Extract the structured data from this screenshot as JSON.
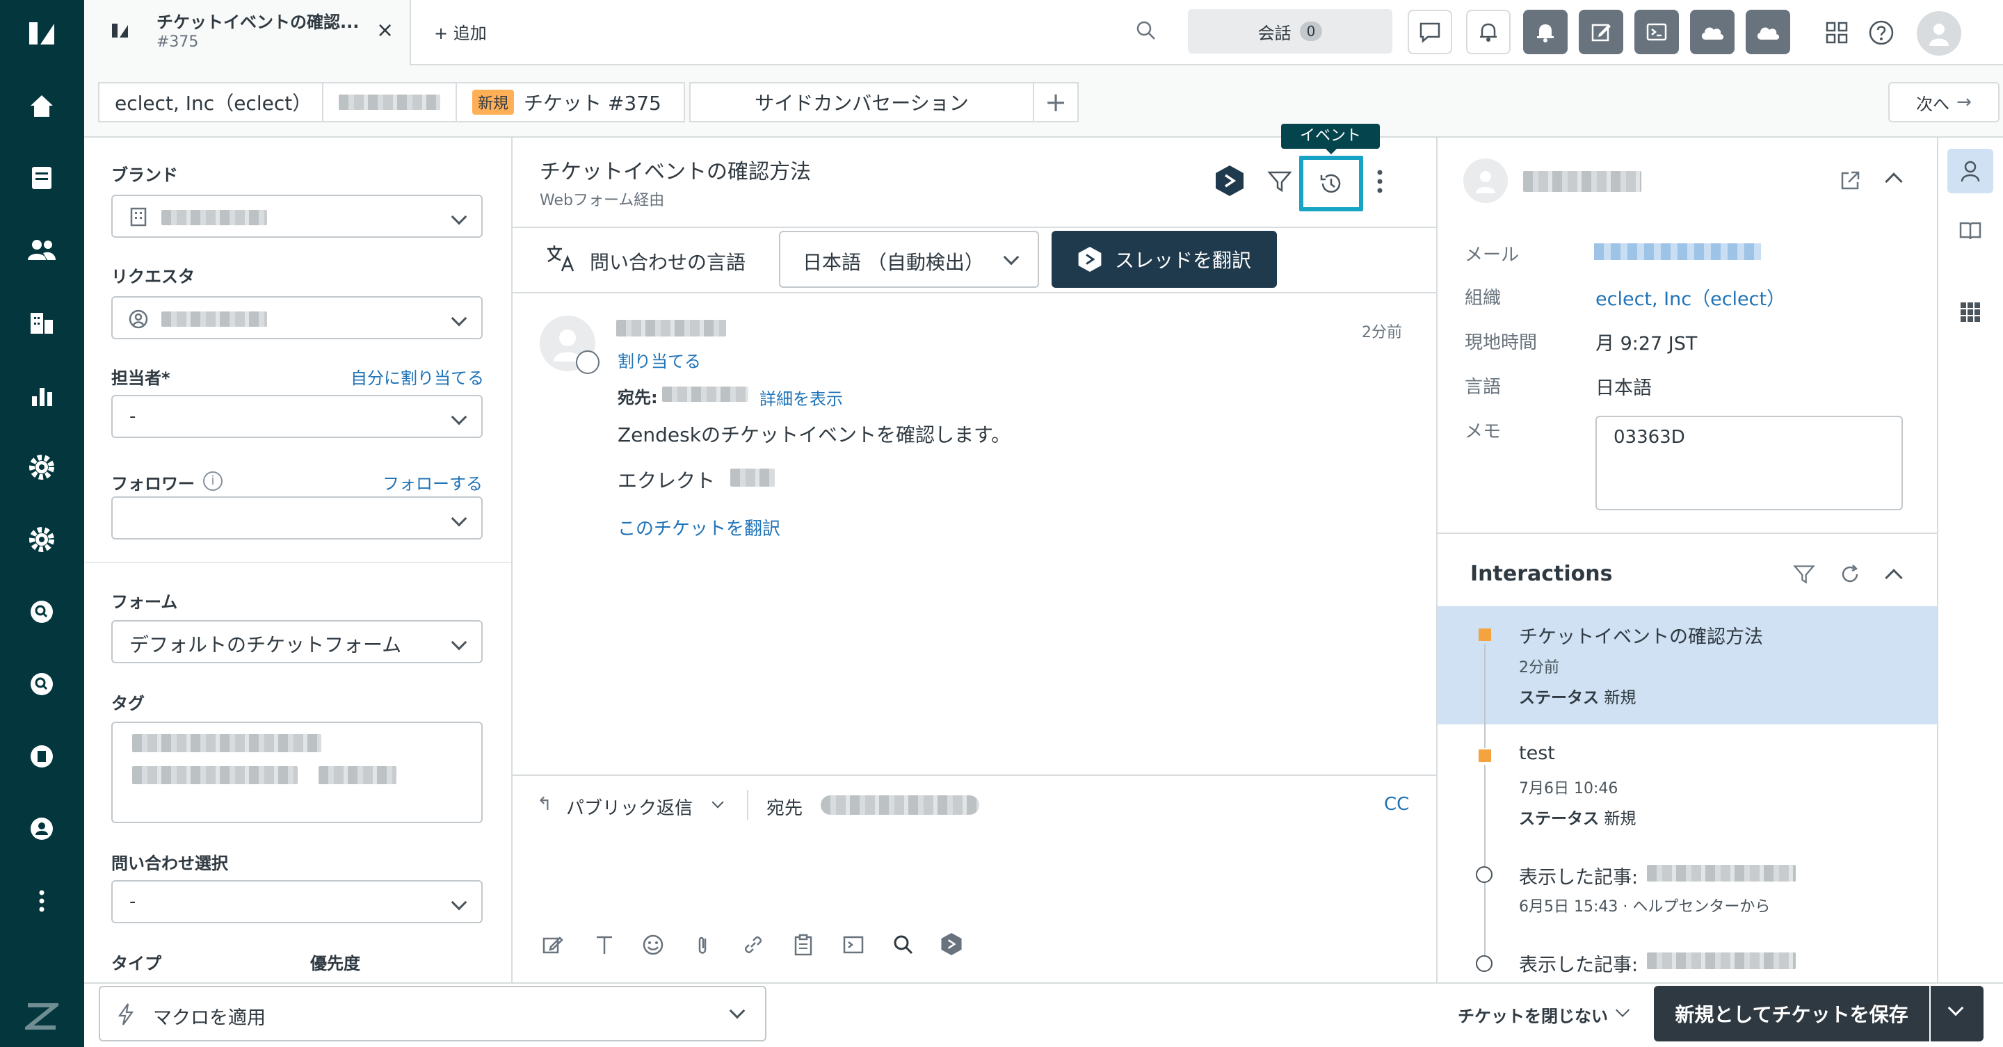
{
  "topbar": {
    "tab_title": "チケットイベントの確認...",
    "tab_subtitle": "#375",
    "add_label": "+ 追加",
    "conversations_label": "会話",
    "conversations_count": "0"
  },
  "subbar": {
    "org_chip": "eclect, Inc（eclect）",
    "new_badge": "新規",
    "ticket_chip": "チケット #375",
    "side_conv_chip": "サイドカンバセーション",
    "next_label": "次へ"
  },
  "left": {
    "brand_label": "ブランド",
    "requester_label": "リクエスタ",
    "assignee_label": "担当者*",
    "assign_self": "自分に割り当てる",
    "assignee_value": "-",
    "followers_label": "フォロワー",
    "follow_link": "フォローする",
    "form_label": "フォーム",
    "form_value": "デフォルトのチケットフォーム",
    "tags_label": "タグ",
    "inquiry_label": "問い合わせ選択",
    "inquiry_value": "-",
    "type_label": "タイプ",
    "priority_label": "優先度"
  },
  "ticket": {
    "title": "チケットイベントの確認方法",
    "via": "Webフォーム経由",
    "tooltip": "イベント",
    "lang_label": "問い合わせの言語",
    "lang_value": "日本語 （自動検出）",
    "translate_thread": "スレッドを翻訳",
    "assign_link": "割り当てる",
    "time_ago": "2分前",
    "to_label": "宛先:",
    "details_link": "詳細を表示",
    "body_line1": "Zendeskのチケットイベントを確認します。",
    "body_line2": "エクレクト",
    "translate_ticket": "このチケットを翻訳",
    "reply_type": "パブリック返信",
    "reply_to_label": "宛先",
    "cc_label": "CC"
  },
  "right": {
    "email_label": "メール",
    "org_label": "組織",
    "org_value": "eclect, Inc（eclect）",
    "local_time_label": "現地時間",
    "local_time_value": "月 9:27 JST",
    "language_label": "言語",
    "language_value": "日本語",
    "memo_label": "メモ",
    "memo_value": "03363D",
    "interactions_title": "Interactions",
    "items": [
      {
        "title": "チケットイベントの確認方法",
        "time": "2分前",
        "status_label": "ステータス",
        "status": "新規"
      },
      {
        "title": "test",
        "time": "7月6日 10:46",
        "status_label": "ステータス",
        "status": "新規"
      },
      {
        "title": "表示した記事:",
        "time": "6月5日 15:43 · ヘルプセンターから"
      },
      {
        "title": "表示した記事:"
      }
    ]
  },
  "bottom": {
    "macro_label": "マクロを適用",
    "keep_open": "チケットを閉じない",
    "save_label": "新規としてチケットを保存"
  },
  "colors": {
    "sidebar": "#03363d",
    "accent_blue": "#1f73b7",
    "save_button": "#2f3941",
    "highlight": "#cfe1f3",
    "new_badge": "#ffb057",
    "tooltip_border": "#17a3c3"
  }
}
